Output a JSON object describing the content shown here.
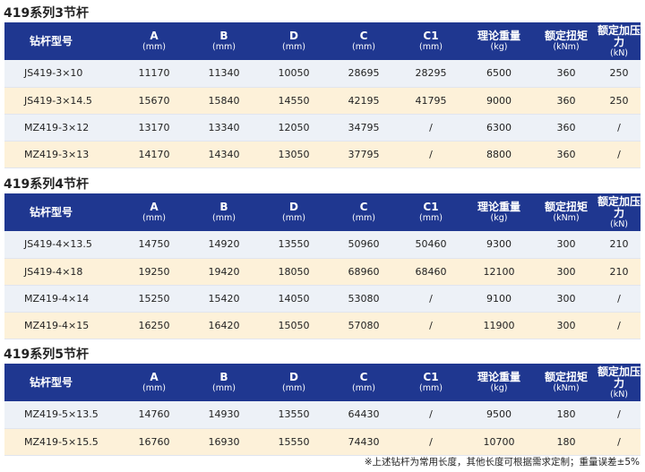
{
  "headers": {
    "model": "钻杆型号",
    "a": "A",
    "b": "B",
    "d": "D",
    "c": "C",
    "c1": "C1",
    "weight": "理论重量",
    "torque": "额定扭矩",
    "force": "额定加压力",
    "mm": "(mm)",
    "kg": "(kg)",
    "knm": "(kNm)",
    "kn": "(kN)"
  },
  "sections": [
    {
      "title": "419系列3节杆",
      "rows": [
        {
          "model": "JS419-3×10",
          "a": "11170",
          "b": "11340",
          "d": "10050",
          "c": "28695",
          "c1": "28295",
          "weight": "6500",
          "torque": "360",
          "force": "250"
        },
        {
          "model": "JS419-3×14.5",
          "a": "15670",
          "b": "15840",
          "d": "14550",
          "c": "42195",
          "c1": "41795",
          "weight": "9000",
          "torque": "360",
          "force": "250"
        },
        {
          "model": "MZ419-3×12",
          "a": "13170",
          "b": "13340",
          "d": "12050",
          "c": "34795",
          "c1": "/",
          "weight": "6300",
          "torque": "360",
          "force": "/"
        },
        {
          "model": "MZ419-3×13",
          "a": "14170",
          "b": "14340",
          "d": "13050",
          "c": "37795",
          "c1": "/",
          "weight": "8800",
          "torque": "360",
          "force": "/"
        }
      ]
    },
    {
      "title": "419系列4节杆",
      "rows": [
        {
          "model": "JS419-4×13.5",
          "a": "14750",
          "b": "14920",
          "d": "13550",
          "c": "50960",
          "c1": "50460",
          "weight": "9300",
          "torque": "300",
          "force": "210"
        },
        {
          "model": "JS419-4×18",
          "a": "19250",
          "b": "19420",
          "d": "18050",
          "c": "68960",
          "c1": "68460",
          "weight": "12100",
          "torque": "300",
          "force": "210"
        },
        {
          "model": "MZ419-4×14",
          "a": "15250",
          "b": "15420",
          "d": "14050",
          "c": "53080",
          "c1": "/",
          "weight": "9100",
          "torque": "300",
          "force": "/"
        },
        {
          "model": "MZ419-4×15",
          "a": "16250",
          "b": "16420",
          "d": "15050",
          "c": "57080",
          "c1": "/",
          "weight": "11900",
          "torque": "300",
          "force": "/"
        }
      ]
    },
    {
      "title": "419系列5节杆",
      "rows": [
        {
          "model": "MZ419-5×13.5",
          "a": "14760",
          "b": "14930",
          "d": "13550",
          "c": "64430",
          "c1": "/",
          "weight": "9500",
          "torque": "180",
          "force": "/"
        },
        {
          "model": "MZ419-5×15.5",
          "a": "16760",
          "b": "16930",
          "d": "15550",
          "c": "74430",
          "c1": "/",
          "weight": "10700",
          "torque": "180",
          "force": "/"
        }
      ]
    }
  ],
  "colors": {
    "header_bg": "#1f3790",
    "row_alt": "#fdf1d9",
    "row_plain": "#edf1f7"
  },
  "footnote": "※上述钻杆为常用长度，其他长度可根据需求定制；重量误差±5%"
}
